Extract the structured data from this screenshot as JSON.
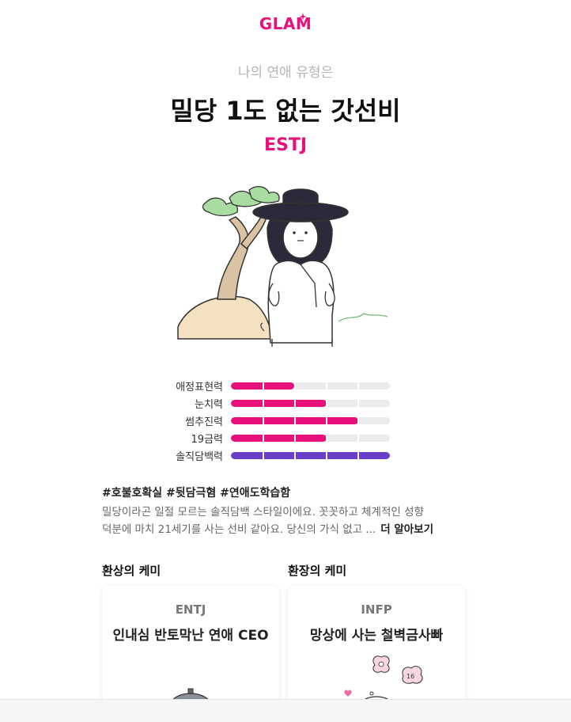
{
  "brand": {
    "logo": "GLAM",
    "color": "#e8107a"
  },
  "result": {
    "subtitle": "나의 연애 유형은",
    "title": "밀당 1도 없는 갓선비",
    "mbti": "ESTJ"
  },
  "stats": [
    {
      "label": "애정표현력",
      "level": 0.4,
      "color": "#e8107a"
    },
    {
      "label": "눈치력",
      "level": 0.6,
      "color": "#e8107a"
    },
    {
      "label": "썸추진력",
      "level": 0.8,
      "color": "#e8107a"
    },
    {
      "label": "19금력",
      "level": 0.6,
      "color": "#e8107a"
    },
    {
      "label": "솔직담백력",
      "level": 1.0,
      "color": "#6a3fc8"
    }
  ],
  "hashtags": "#호불호확실 #뒷담극혐 #연애도학습함",
  "description": {
    "line1": "밀당이라곤 일절 모르는 솔직담백 스타일이에요. 꼿꼿하고 체계적인 성향",
    "line2": "덕분에 마치 21세기를 사는 선비 같아요. 당신의 가식 없고 ...",
    "more": "더 알아보기"
  },
  "chemistry": {
    "good": {
      "heading": "환상의 케미",
      "mbti": "ENTJ",
      "title": "인내심 반토막난 연애 CEO"
    },
    "bad": {
      "heading": "환장의 케미",
      "mbti": "INFP",
      "title": "망상에 사는 철벽금사빠"
    }
  }
}
